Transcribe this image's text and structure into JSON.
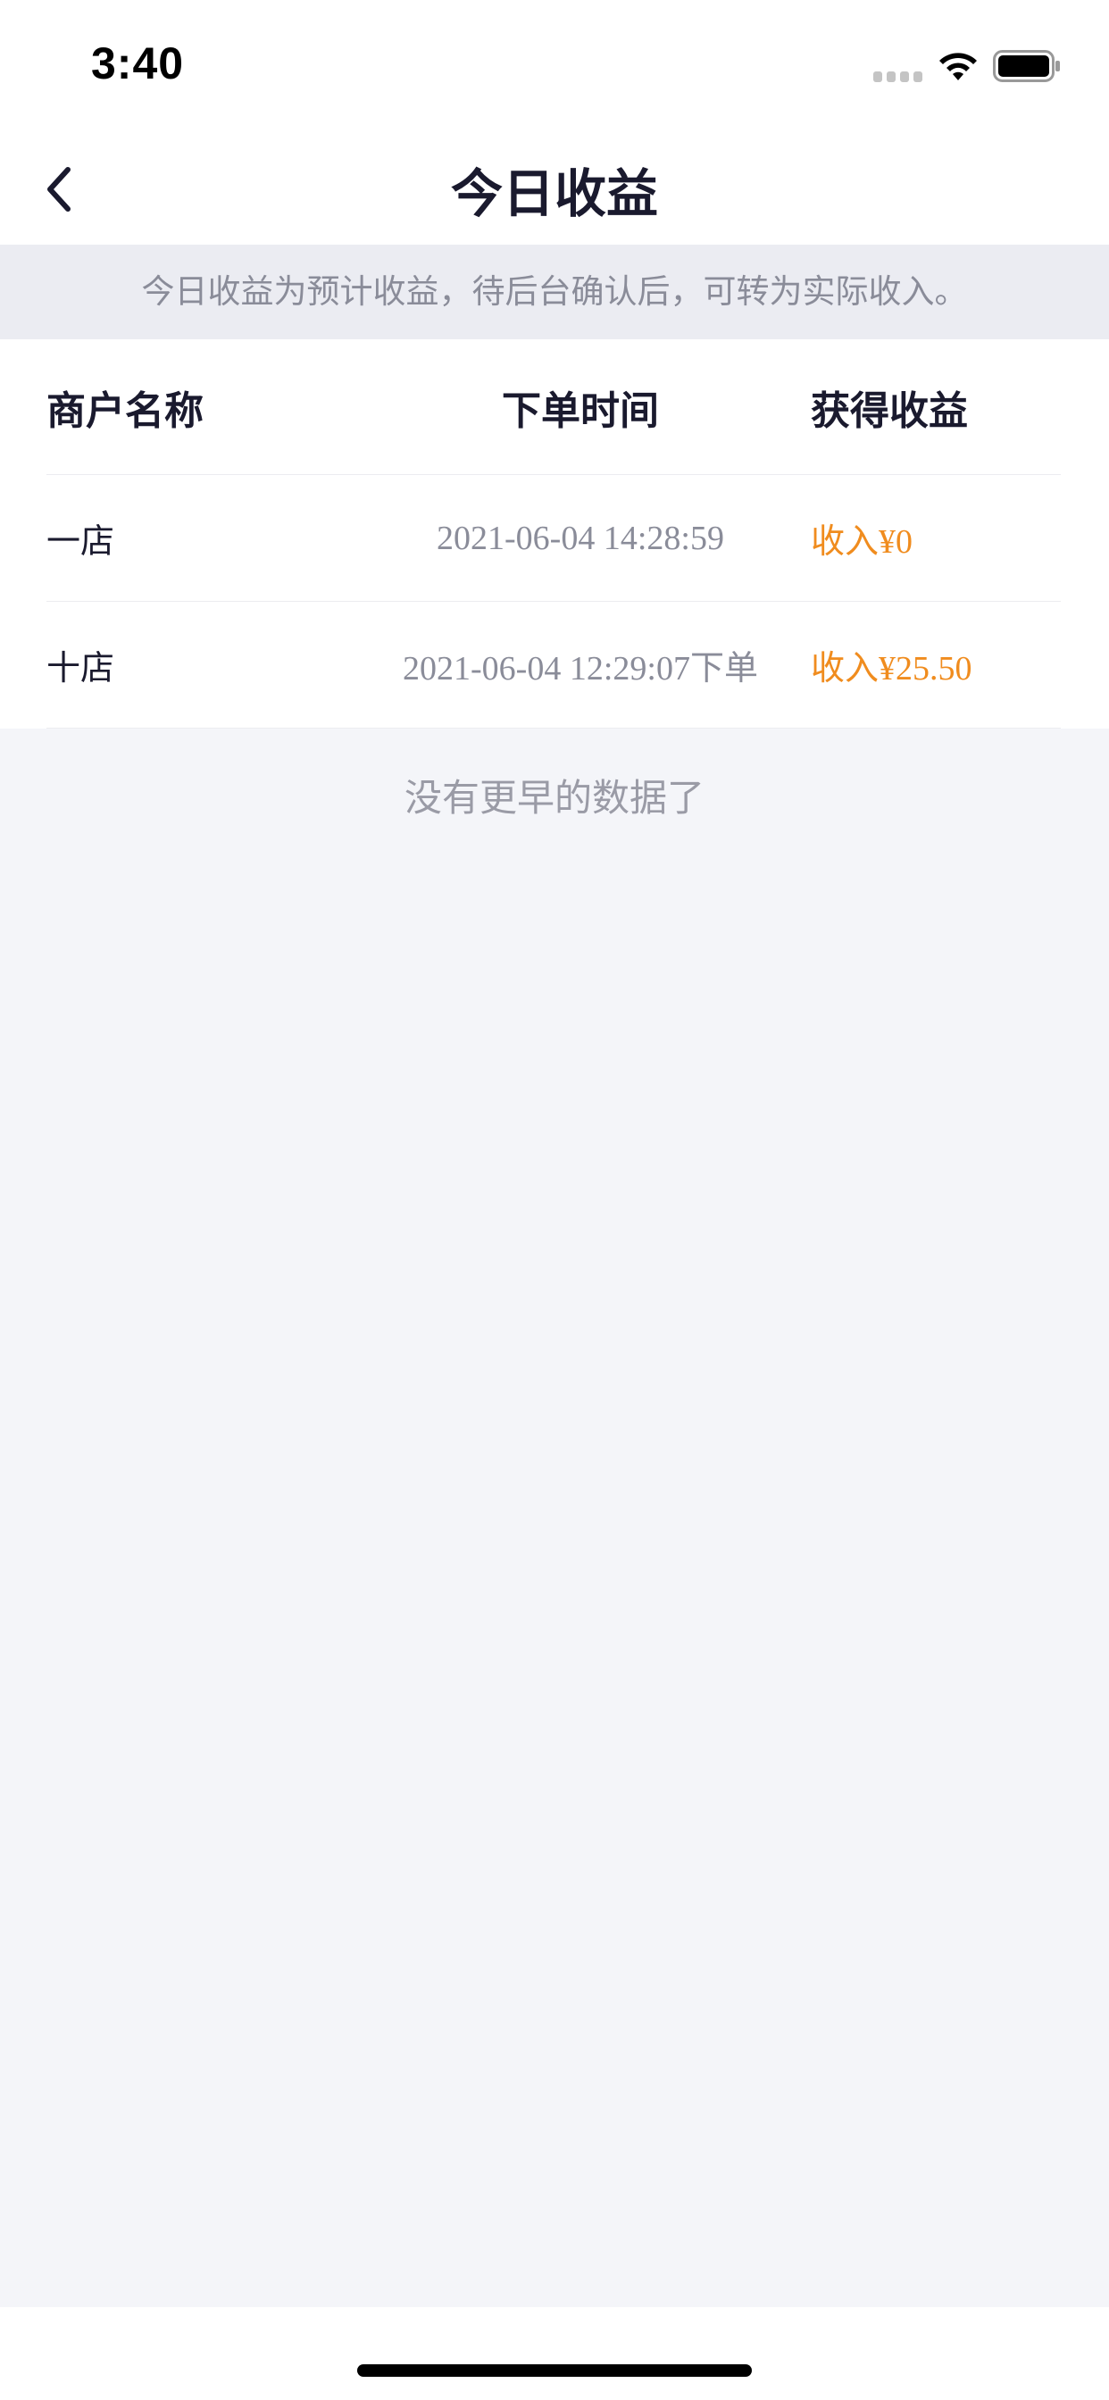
{
  "status_bar": {
    "time": "3:40"
  },
  "nav": {
    "title": "今日收益",
    "back_icon": "chevron-left-icon"
  },
  "notice": {
    "text": "今日收益为预计收益，待后台确认后，可转为实际收入。"
  },
  "table": {
    "columns": [
      "商户名称",
      "下单时间",
      "获得收益"
    ],
    "rows": [
      {
        "merchant": "一店",
        "time": "2021-06-04 14:28:59",
        "income": "收入¥0"
      },
      {
        "merchant": "十店",
        "time": "2021-06-04 12:29:07下单",
        "income": "收入¥25.50"
      }
    ]
  },
  "footer": {
    "no_more_text": "没有更早的数据了"
  },
  "colors": {
    "background": "#f4f5f9",
    "notice_bg": "#ebecf2",
    "income_accent": "#f08c1e",
    "title_text": "#1a1a2e",
    "muted_text": "#8a8c99"
  }
}
